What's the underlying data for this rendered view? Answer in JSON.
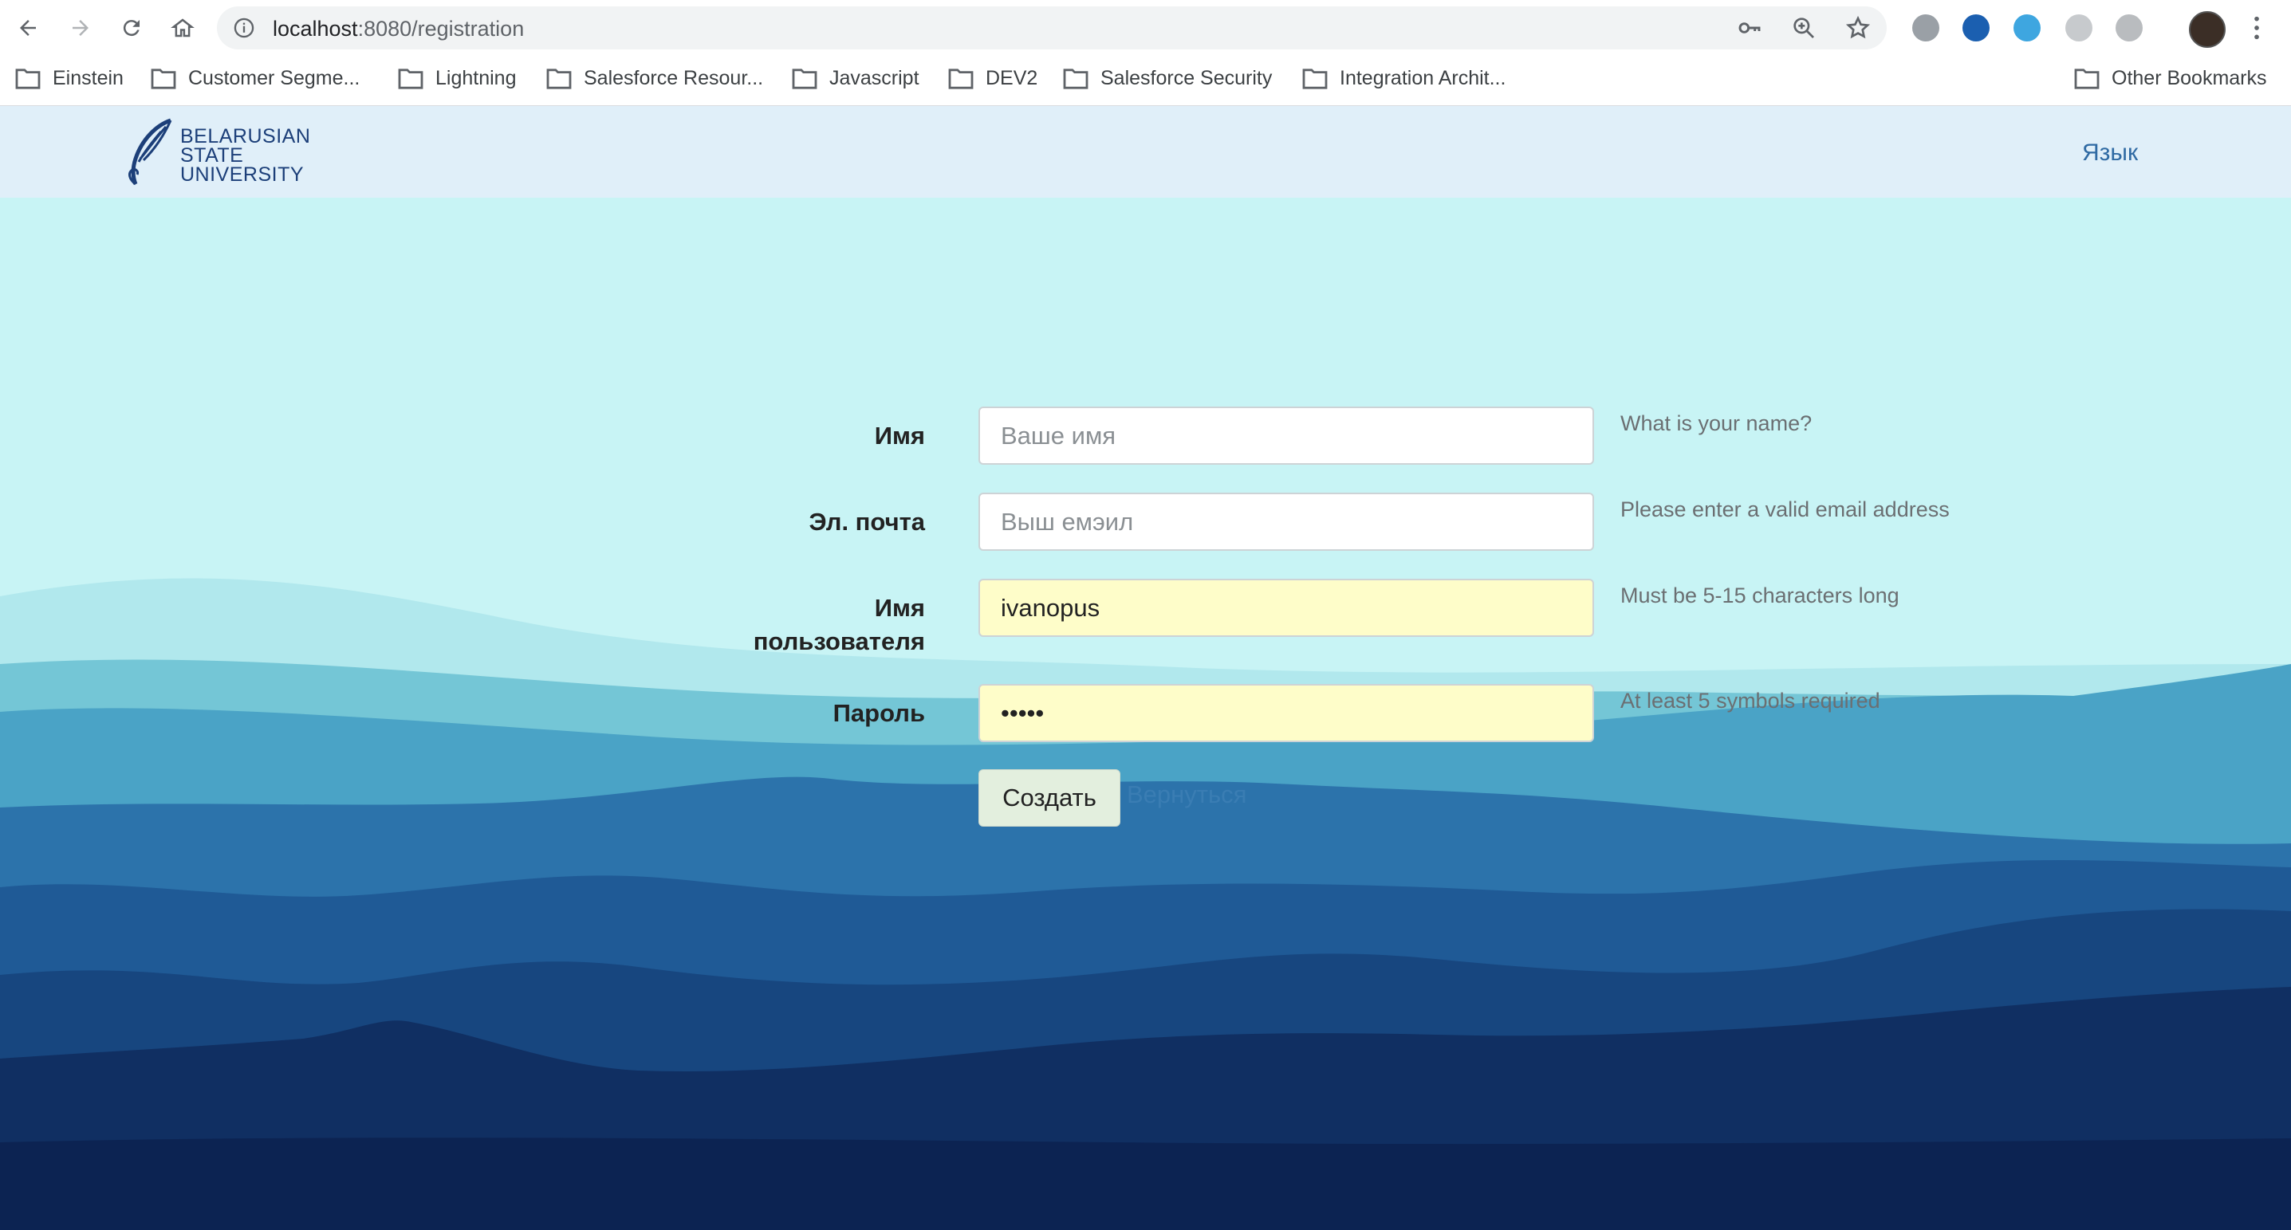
{
  "browser": {
    "url_host": "localhost",
    "url_path": ":8080/registration",
    "bookmarks": [
      "Einstein",
      "Customer Segme...",
      "Lightning",
      "Salesforce Resour...",
      "Javascript",
      "DEV2",
      "Salesforce Security",
      "Integration Archit..."
    ],
    "other_bookmarks": "Other Bookmarks"
  },
  "header": {
    "logo_lines": [
      "BELARUSIAN",
      "STATE",
      "UNIVERSITY"
    ],
    "language_link": "Язык"
  },
  "form": {
    "name": {
      "label": "Имя",
      "placeholder": "Ваше имя",
      "value": "",
      "hint": "What is your name?"
    },
    "email": {
      "label": "Эл. почта",
      "placeholder": "Выш емэил",
      "value": "",
      "hint": "Please enter a valid email address"
    },
    "username": {
      "label_line1": "Имя",
      "label_line2": "пользователя",
      "value": "ivanopus",
      "hint": "Must be 5-15 characters long"
    },
    "password": {
      "label": "Пароль",
      "value": "•••••",
      "hint": "At least 5 symbols required"
    },
    "submit_label": "Создать",
    "back_label": "Вернуться"
  },
  "colors": {
    "sky": "#c8f4f5",
    "header_bg": "#e0eff9",
    "autofill": "#fefdc9",
    "mountain_far": "#5aaecb",
    "mountain_mid": "#2a6ea8",
    "mountain_near": "#153f7a",
    "mountain_front": "#0d2654"
  }
}
